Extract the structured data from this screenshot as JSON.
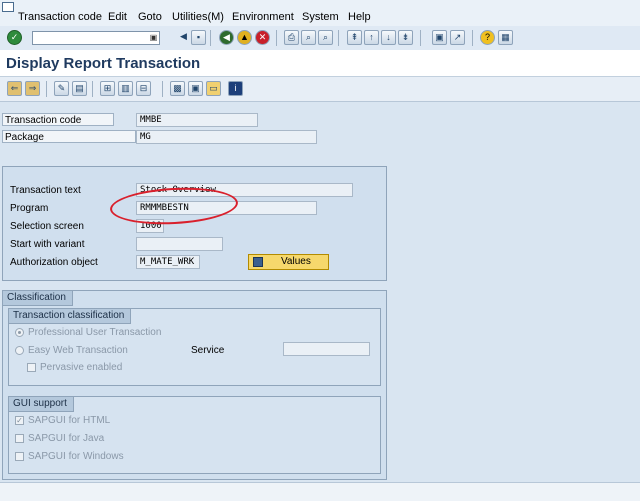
{
  "menu": {
    "items": [
      "Transaction code",
      "Edit",
      "Goto",
      "Utilities(M)",
      "Environment",
      "System",
      "Help"
    ]
  },
  "toolbar": {
    "command_field_value": ""
  },
  "header": {
    "title": "Display Report Transaction"
  },
  "fields": {
    "transaction_code": {
      "label": "Transaction code",
      "value": "MMBE"
    },
    "package": {
      "label": "Package",
      "value": "MG"
    },
    "transaction_text": {
      "label": "Transaction text",
      "value": "Stock Overview"
    },
    "program": {
      "label": "Program",
      "value": "RMMMBESTN"
    },
    "selection_screen": {
      "label": "Selection screen",
      "value": "1000"
    },
    "start_with_variant": {
      "label": "Start with variant",
      "value": ""
    },
    "authorization_object": {
      "label": "Authorization object",
      "value": "M_MATE_WRK"
    }
  },
  "values_button": {
    "label": "Values"
  },
  "classification": {
    "title": "Classification",
    "transaction_classification": {
      "title": "Transaction classification",
      "professional_label": "Professional User Transaction",
      "easy_web_label": "Easy Web Transaction",
      "service_label": "Service",
      "service_value": "",
      "pervasive_label": "Pervasive enabled",
      "selected": "professional"
    },
    "gui_support": {
      "title": "GUI support",
      "html_label": "SAPGUI for HTML",
      "html_checked": true,
      "java_label": "SAPGUI for Java",
      "java_checked": false,
      "windows_label": "SAPGUI for Windows",
      "windows_checked": false
    }
  },
  "colors": {
    "background": "#d9e5f1",
    "title_text": "#1f3a5f",
    "annotation_red": "#d9202c",
    "values_button": "#f6d86c"
  }
}
